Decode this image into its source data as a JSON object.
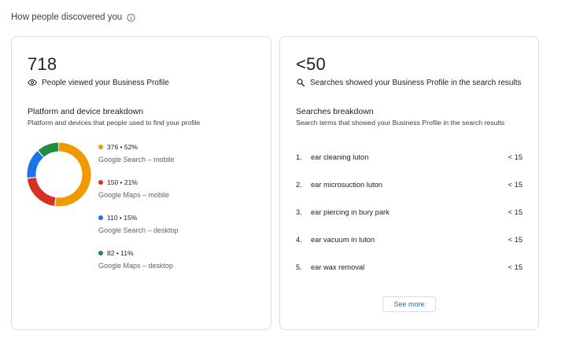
{
  "header": {
    "title": "How people discovered you"
  },
  "views_card": {
    "count": "718",
    "count_label": "People viewed your Business Profile",
    "section_title": "Platform and device breakdown",
    "section_subtitle": "Platform and devices that people used to find your profile",
    "breakdown": [
      {
        "stat": "376 • 52%",
        "label": "Google Search – mobile",
        "value": 376,
        "percent": 52,
        "color": "#f29900"
      },
      {
        "stat": "150 • 21%",
        "label": "Google Maps – mobile",
        "value": 150,
        "percent": 21,
        "color": "#d93025"
      },
      {
        "stat": "110 • 15%",
        "label": "Google Search – desktop",
        "value": 110,
        "percent": 15,
        "color": "#1a73e8"
      },
      {
        "stat": "82 • 11%",
        "label": "Google Maps – desktop",
        "value": 82,
        "percent": 11,
        "color": "#1e8e3e"
      }
    ]
  },
  "search_card": {
    "count": "<50",
    "count_label": "Searches showed your Business Profile in the search results",
    "section_title": "Searches breakdown",
    "section_subtitle": "Search terms that showed your Business Profile in the search results",
    "terms": [
      {
        "index": "1.",
        "term": "ear cleaning luton",
        "value": "< 15"
      },
      {
        "index": "2.",
        "term": "ear microsuction luton",
        "value": "< 15"
      },
      {
        "index": "3.",
        "term": "ear piercing in bury park",
        "value": "< 15"
      },
      {
        "index": "4.",
        "term": "ear vacuum in luton",
        "value": "< 15"
      },
      {
        "index": "5.",
        "term": "ear wax removal",
        "value": "< 15"
      }
    ],
    "see_more_label": "See more"
  }
}
